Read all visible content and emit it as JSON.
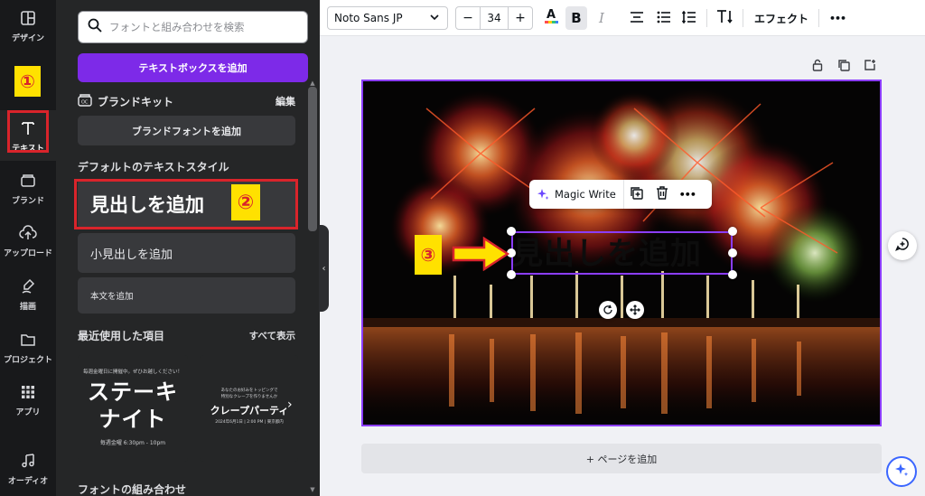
{
  "rail": {
    "items": [
      {
        "label": "デザイン",
        "icon": "layout-icon"
      },
      {
        "label": "テキスト",
        "icon": "text-icon"
      },
      {
        "label": "ブランド",
        "icon": "brand-icon"
      },
      {
        "label": "アップロード",
        "icon": "upload-icon"
      },
      {
        "label": "描画",
        "icon": "draw-icon"
      },
      {
        "label": "プロジェクト",
        "icon": "folder-icon"
      },
      {
        "label": "アプリ",
        "icon": "apps-icon"
      },
      {
        "label": "オーディオ",
        "icon": "audio-icon"
      }
    ]
  },
  "annotations": {
    "step1": "①",
    "step2": "②",
    "step3": "③",
    "highlight_color": "#d9242b",
    "badge_color": "#ffe100"
  },
  "panel": {
    "search_placeholder": "フォントと組み合わせを検索",
    "add_textbox": "テキストボックスを追加",
    "brand_kit": "ブランドキット",
    "brand_edit": "編集",
    "add_brand_font": "ブランドフォントを追加",
    "default_styles_title": "デフォルトのテキストスタイル",
    "add_heading": "見出しを追加",
    "add_subheading": "小見出しを追加",
    "add_body": "本文を追加",
    "recent_title": "最近使用した項目",
    "see_all": "すべて表示",
    "font_combos_title": "フォントの組み合わせ",
    "recent_items": {
      "steak": {
        "small": "毎週金曜日に開催中。ぜひお越しください！",
        "title_line1": "ステーキ",
        "title_line2": "ナイト",
        "time": "毎週金曜 6:30pm - 10pm"
      },
      "crepe": {
        "small1": "あなたのお好みをトッピングで",
        "small2": "特別なクレープを作りませんか",
        "title": "クレープパーティ",
        "time": "2024年6月1日 | 2:00 PM | 東京都内"
      }
    }
  },
  "toolbar": {
    "font_name": "Noto Sans JP",
    "font_size": "34",
    "minus": "−",
    "plus": "+",
    "effects": "エフェクト",
    "more": "•••"
  },
  "canvas": {
    "heading_text": "見出しを追加",
    "magic_write": "Magic Write",
    "add_page": "+ ページを追加",
    "accent": "#8b3dff"
  }
}
